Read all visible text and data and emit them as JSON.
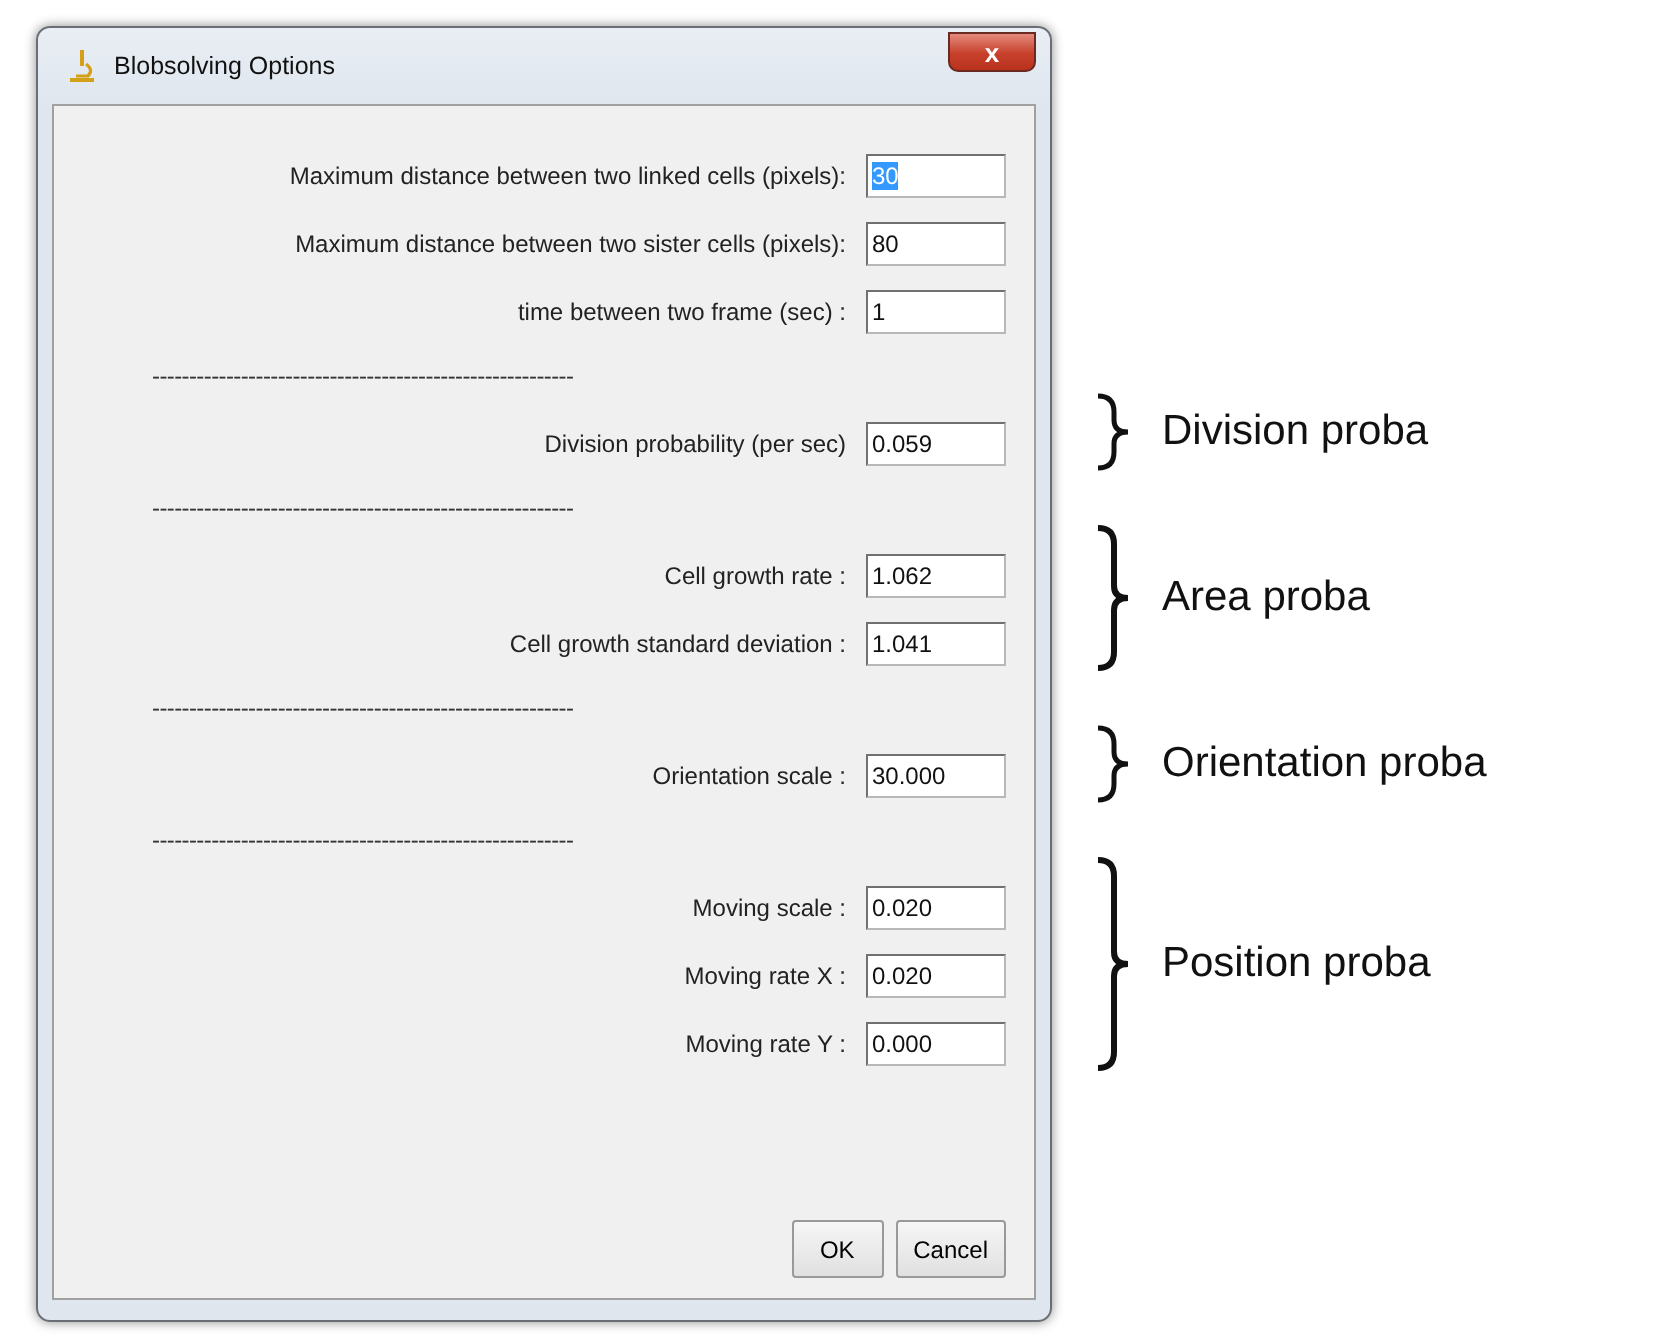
{
  "window": {
    "title": "Blobsolving Options",
    "close": "x"
  },
  "sections": [
    {
      "fields": [
        {
          "label": "Maximum distance between two linked cells (pixels):",
          "value": "30",
          "selected": true
        },
        {
          "label": "Maximum distance between two sister cells (pixels):",
          "value": "80",
          "selected": false
        },
        {
          "label": "time between two frame (sec) :",
          "value": "1",
          "selected": false
        }
      ]
    },
    {
      "separator": "---------------------------------------------------------",
      "annotation": "Division proba",
      "fields": [
        {
          "label": "Division probability (per sec)",
          "value": "0.059",
          "selected": false
        }
      ]
    },
    {
      "separator": "---------------------------------------------------------",
      "annotation": "Area proba",
      "fields": [
        {
          "label": "Cell growth rate :",
          "value": "1.062",
          "selected": false
        },
        {
          "label": "Cell growth standard deviation :",
          "value": "1.041",
          "selected": false
        }
      ]
    },
    {
      "separator": "---------------------------------------------------------",
      "annotation": "Orientation proba",
      "fields": [
        {
          "label": "Orientation scale :",
          "value": "30.000",
          "selected": false
        }
      ]
    },
    {
      "separator": "---------------------------------------------------------",
      "annotation": "Position proba",
      "fields": [
        {
          "label": "Moving scale :",
          "value": "0.020",
          "selected": false
        },
        {
          "label": "Moving rate X :",
          "value": "0.020",
          "selected": false
        },
        {
          "label": "Moving rate Y :",
          "value": "0.000",
          "selected": false
        }
      ]
    }
  ],
  "buttons": [
    "OK",
    "Cancel"
  ]
}
